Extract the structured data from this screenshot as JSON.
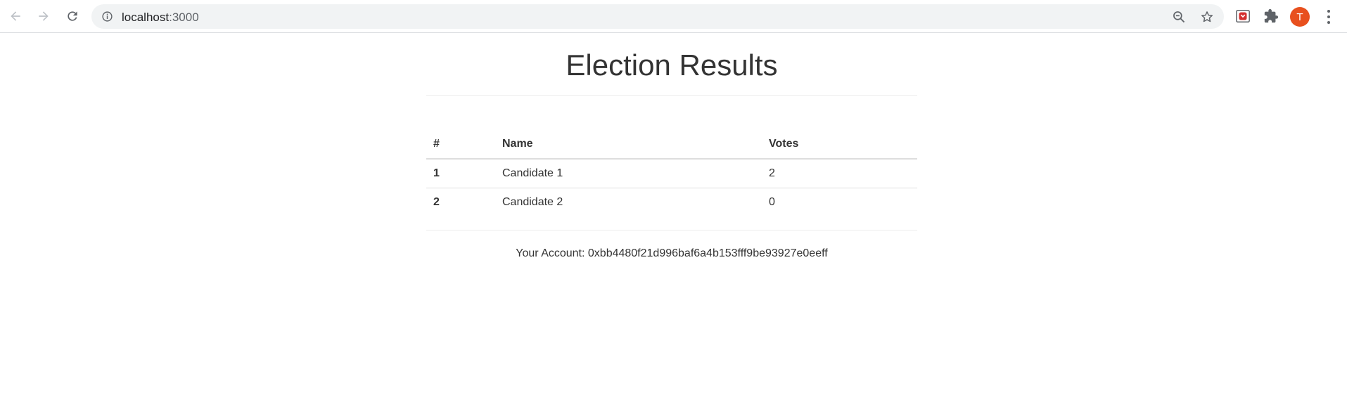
{
  "browser": {
    "url_host": "localhost",
    "url_port": ":3000",
    "profile_initial": "T",
    "icons": [
      "back-icon",
      "forward-icon",
      "reload-icon",
      "info-icon",
      "zoom-out-icon",
      "star-icon",
      "pocket-extension-icon",
      "puzzle-extension-icon",
      "kebab-menu-icon"
    ],
    "colors": {
      "avatar": "#e8501e",
      "omnibox": "#f1f3f4"
    }
  },
  "page": {
    "title": "Election Results",
    "table": {
      "headers": {
        "index": "#",
        "name": "Name",
        "votes": "Votes"
      },
      "rows": [
        {
          "index": "1",
          "name": "Candidate 1",
          "votes": "2"
        },
        {
          "index": "2",
          "name": "Candidate 2",
          "votes": "0"
        }
      ]
    },
    "account": "Your Account: 0xbb4480f21d996baf6a4b153fff9be93927e0eeff"
  }
}
